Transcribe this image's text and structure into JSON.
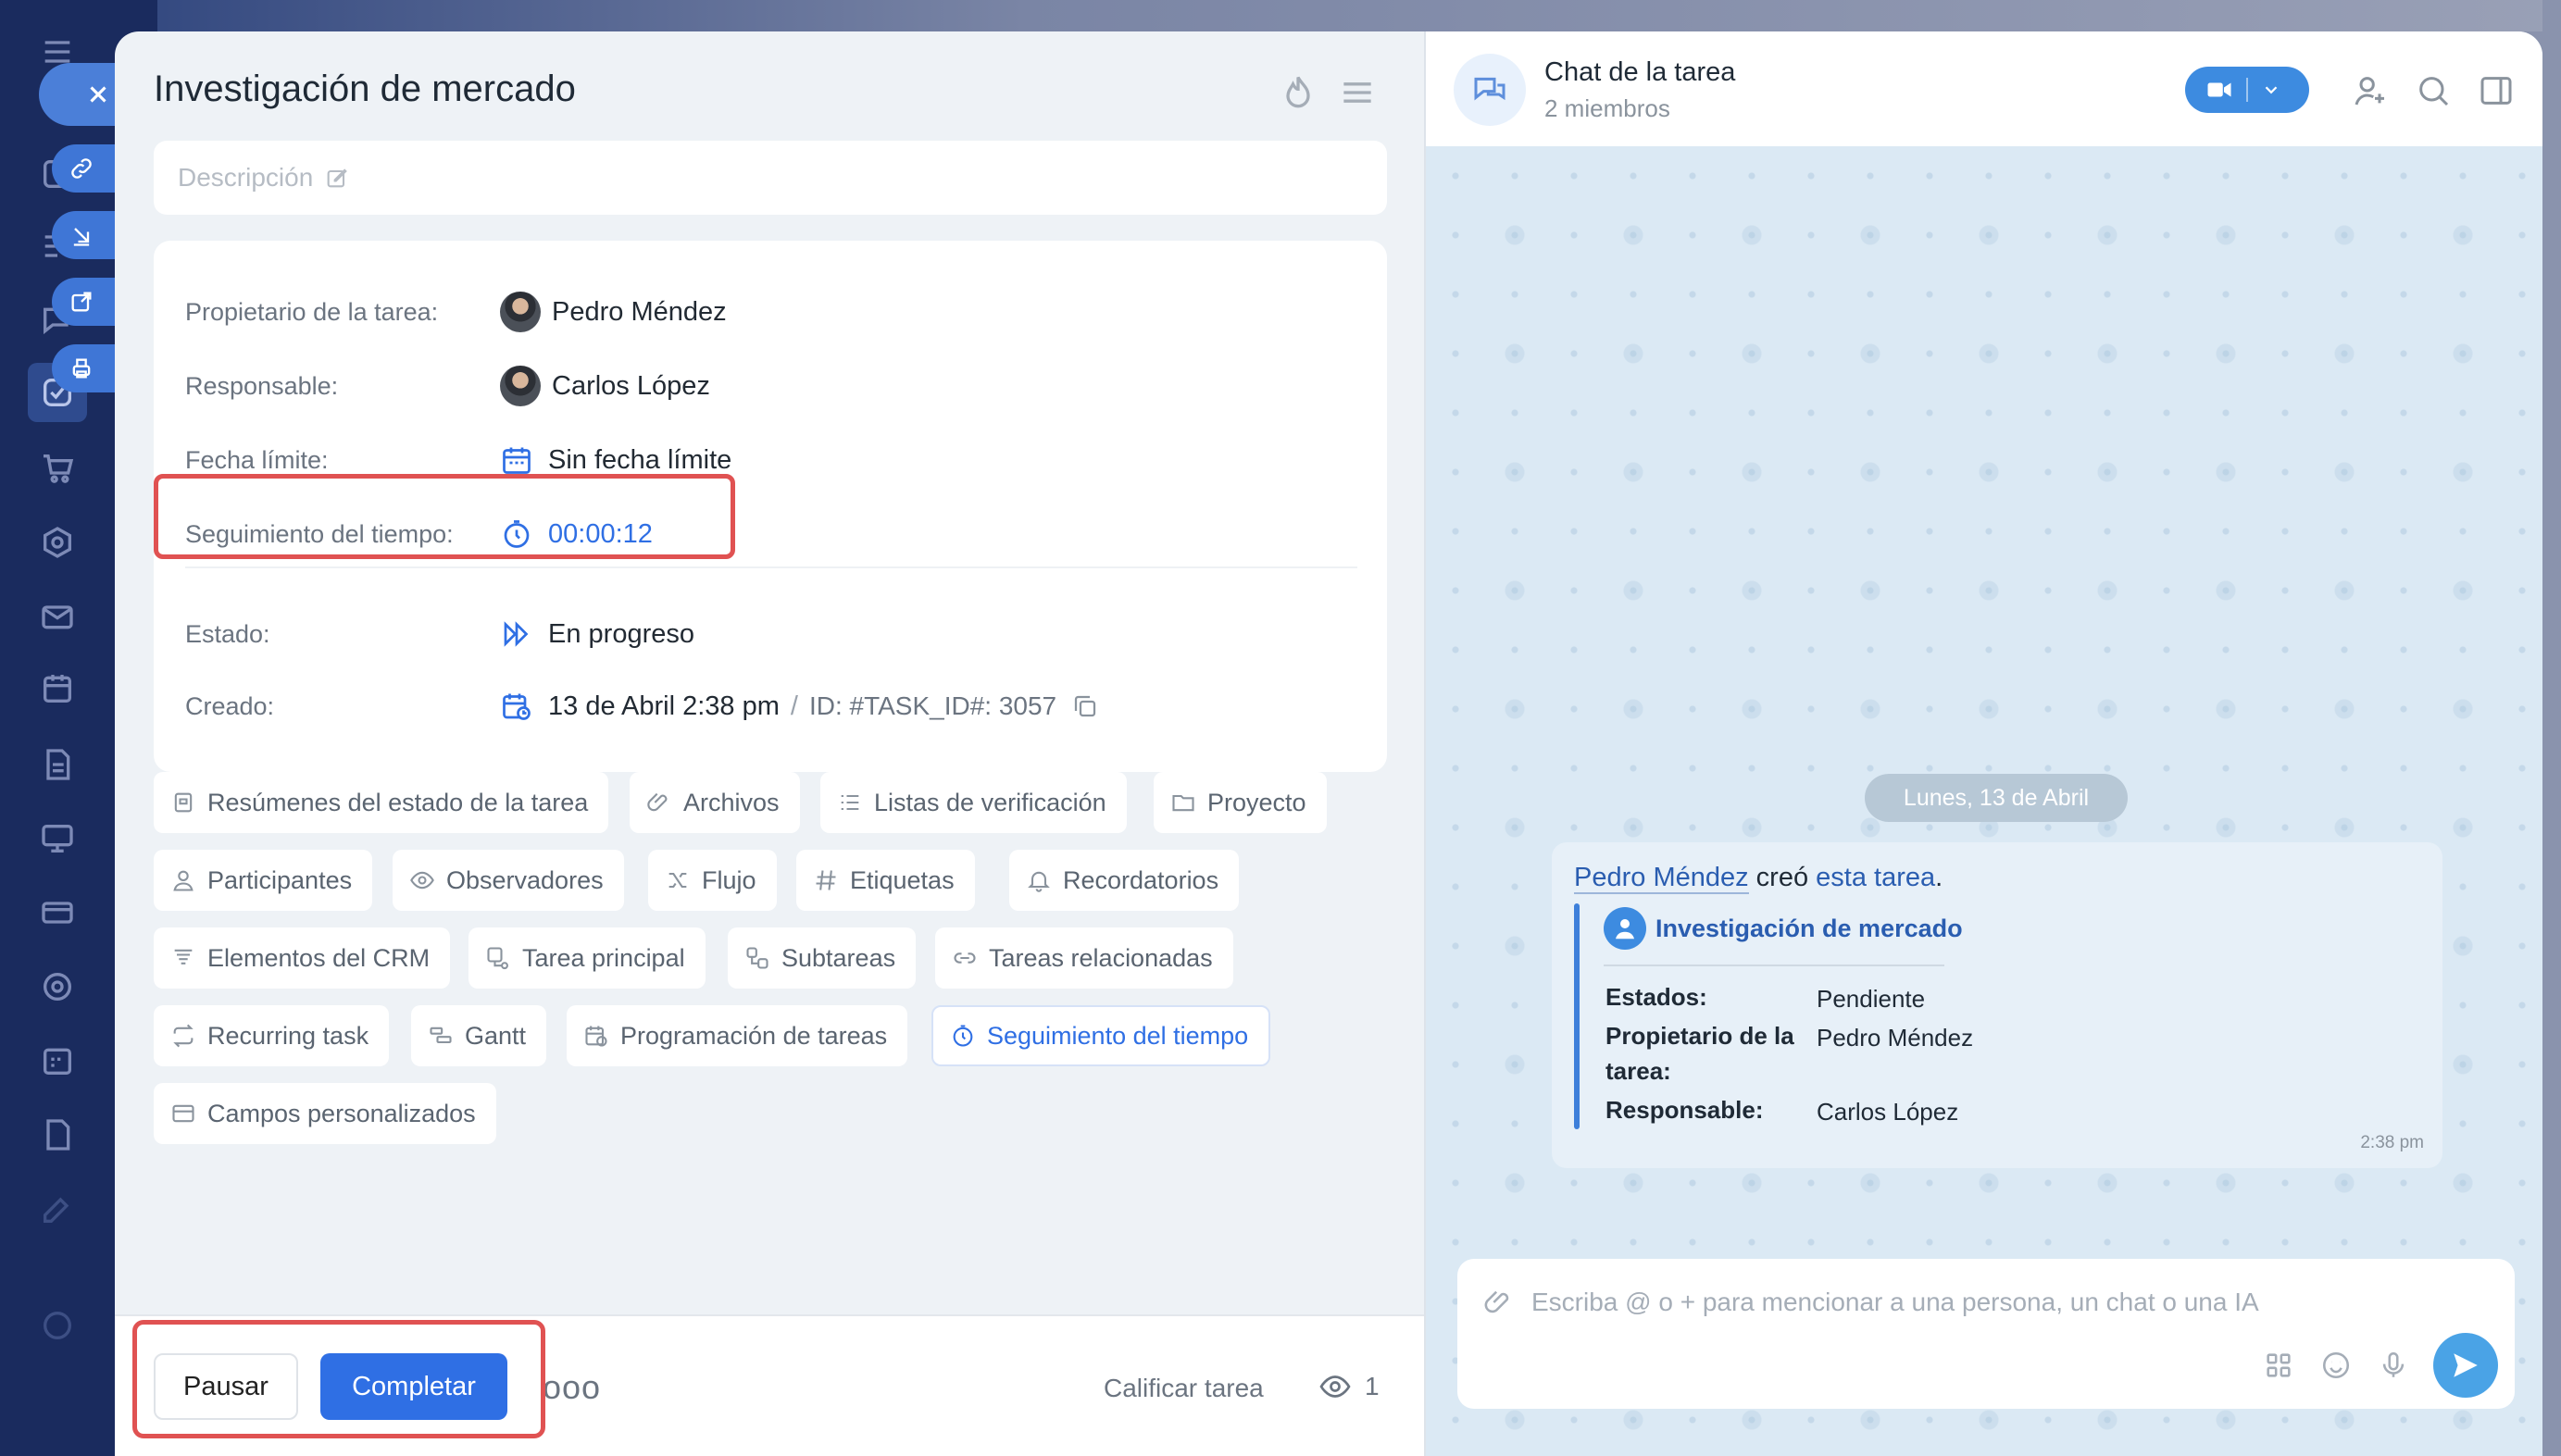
{
  "task": {
    "title": "Investigación de mercado",
    "description_placeholder": "Descripción",
    "details": {
      "owner_label": "Propietario de la tarea:",
      "owner_value": "Pedro Méndez",
      "responsible_label": "Responsable:",
      "responsible_value": "Carlos López",
      "deadline_label": "Fecha límite:",
      "deadline_value": "Sin fecha límite",
      "time_tracking_label": "Seguimiento del tiempo:",
      "time_tracking_value": "00:00:12",
      "status_label": "Estado:",
      "status_value": "En progreso",
      "created_label": "Creado:",
      "created_value": "13 de Abril 2:38 pm",
      "id_separator": "/",
      "id_value": "ID: #TASK_ID#: 3057"
    },
    "chips": [
      {
        "label": "Resúmenes del estado de la tarea",
        "icon": "summary-icon"
      },
      {
        "label": "Archivos",
        "icon": "paperclip-icon"
      },
      {
        "label": "Listas de verificación",
        "icon": "checklist-icon"
      },
      {
        "label": "Proyecto",
        "icon": "folder-icon"
      },
      {
        "label": "Participantes",
        "icon": "person-icon"
      },
      {
        "label": "Observadores",
        "icon": "eye-icon"
      },
      {
        "label": "Flujo",
        "icon": "flow-icon"
      },
      {
        "label": "Etiquetas",
        "icon": "hashtag-icon"
      },
      {
        "label": "Recordatorios",
        "icon": "bell-icon"
      },
      {
        "label": "Elementos del CRM",
        "icon": "crm-icon"
      },
      {
        "label": "Tarea principal",
        "icon": "parent-task-icon"
      },
      {
        "label": "Subtareas",
        "icon": "subtasks-icon"
      },
      {
        "label": "Tareas relacionadas",
        "icon": "link-icon"
      },
      {
        "label": "Recurring task",
        "icon": "repeat-icon"
      },
      {
        "label": "Gantt",
        "icon": "gantt-icon"
      },
      {
        "label": "Programación de tareas",
        "icon": "schedule-icon"
      },
      {
        "label": "Seguimiento del tiempo",
        "icon": "stopwatch-icon"
      },
      {
        "label": "Campos personalizados",
        "icon": "custom-fields-icon"
      }
    ],
    "footer": {
      "pause_label": "Pausar",
      "complete_label": "Completar",
      "more_label": "ooo",
      "rate_label": "Calificar tarea",
      "views_count": "1"
    }
  },
  "chat": {
    "title": "Chat de la tarea",
    "subtitle": "2 miembros",
    "date_divider": "Lunes, 13 de Abril",
    "message": {
      "author": "Pedro Méndez",
      "verb": " creó ",
      "link_text": "esta tarea",
      "end_punct": ".",
      "card_title": "Investigación de mercado",
      "rows": [
        {
          "key": "Estados:",
          "value": "Pendiente"
        },
        {
          "key": "Propietario de la tarea:",
          "value": "Pedro Méndez"
        },
        {
          "key": "Responsable:",
          "value": "Carlos López"
        }
      ],
      "time": "2:38 pm"
    },
    "composer_placeholder": "Escriba @ o + para mencionar a una persona, un chat o una IA"
  },
  "colors": {
    "accent": "#2f6fe4",
    "highlight": "#e05252",
    "nav_bg": "#1a2b5e"
  }
}
